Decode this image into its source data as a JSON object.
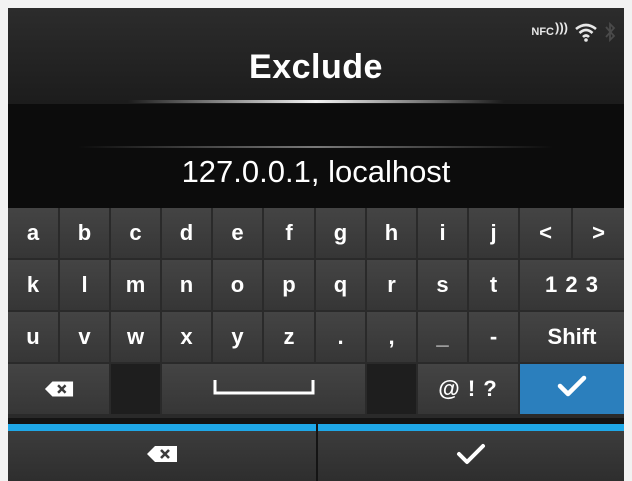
{
  "header": {
    "title": "Exclude",
    "status": {
      "nfc_label": "NFC",
      "wifi": "wifi-icon",
      "bluetooth": "bluetooth-icon"
    }
  },
  "input": {
    "value": "127.0.0.1, localhost"
  },
  "keyboard": {
    "row1": [
      "a",
      "b",
      "c",
      "d",
      "e",
      "f",
      "g",
      "h",
      "i",
      "j",
      "<",
      ">"
    ],
    "row2": [
      "k",
      "l",
      "m",
      "n",
      "o",
      "p",
      "q",
      "r",
      "s",
      "t"
    ],
    "mode_key": "1 2 3",
    "row3": [
      "u",
      "v",
      "w",
      "x",
      "y",
      "z",
      ".",
      ",",
      "_",
      "-"
    ],
    "shift_key": "Shift",
    "symbols_key": "@ ! ?",
    "icons": {
      "backspace": "backspace-icon",
      "space": "space-bar-icon",
      "enter": "checkmark-icon"
    },
    "accent_color": "#2b7fbd"
  },
  "softkeys": {
    "left": "backspace-icon",
    "right": "checkmark-icon",
    "bar_color": "#1fa8e8"
  }
}
